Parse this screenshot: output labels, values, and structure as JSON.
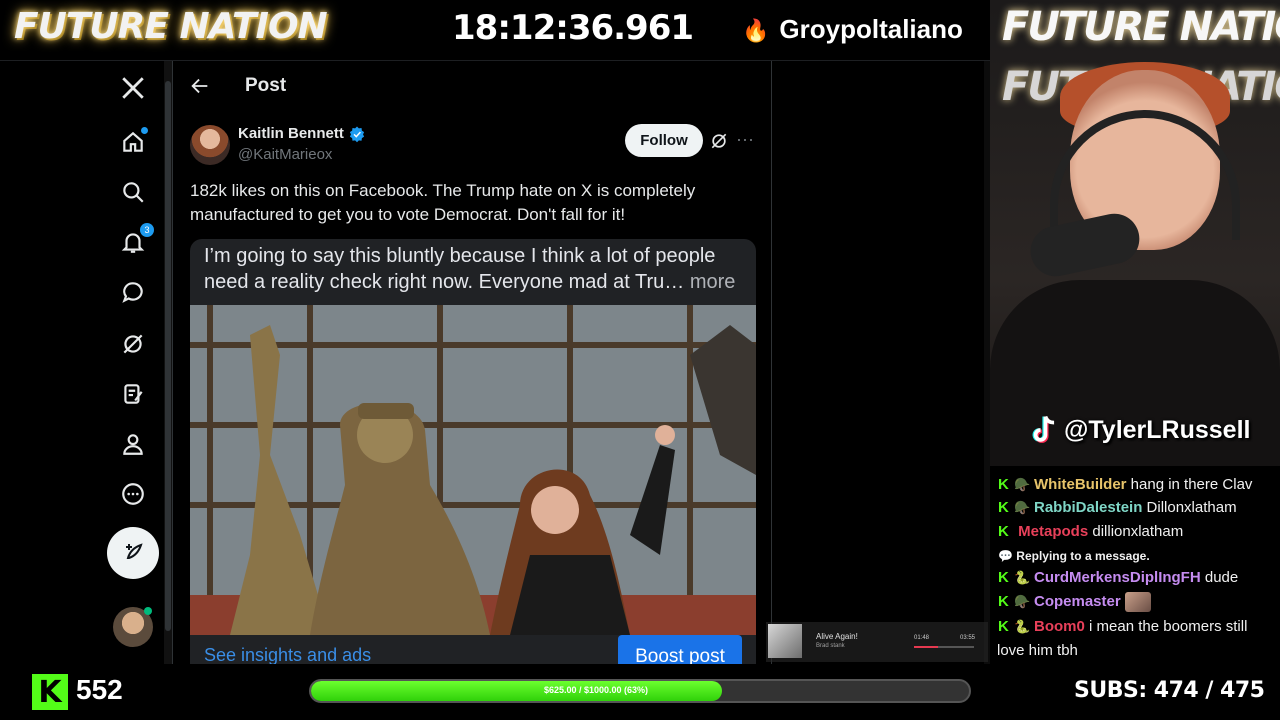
{
  "overlay": {
    "brand": "FUTURE NATION",
    "clock": "18:12:36.961",
    "donor_name": "Groypoltaliano",
    "tiktok_handle": "@TylerLRussell",
    "viewer_count": "552",
    "goal_text": "$625.00 / $1000.00 (63%)",
    "goal_progress": 0.625,
    "subs_text": "SUBS:  474 / 475"
  },
  "nav": {
    "notifications_count": "3",
    "items": [
      "x-logo",
      "home",
      "explore",
      "notifications",
      "messages",
      "grok",
      "lists",
      "profile",
      "more",
      "post"
    ]
  },
  "post_page": {
    "title": "Post",
    "author_name": "Kaitlin Bennett",
    "author_handle": "@KaitMarieox",
    "follow_label": "Follow",
    "text": "182k likes on this on Facebook. The Trump hate on X is completely manufactured to get you to vote Democrat. Don't fall for it!",
    "quote_text": "I’m going to say this bluntly because I think a lot of people need a reality check right now. Everyone mad at Tru…",
    "quote_more": "more",
    "insights_label": "See insights and ads",
    "boost_label": "Boost post"
  },
  "music": {
    "title": "Alive Again!",
    "artist": "Brad stank",
    "time_elapsed": "01:48",
    "time_total": "03:55",
    "progress": 0.4
  },
  "chat": [
    {
      "user": "WhiteBuilder",
      "color": "#e7c46a",
      "rank": "🪖",
      "message": "hang in there Clav"
    },
    {
      "user": "RabbiDalestein",
      "color": "#7fd6c6",
      "rank": "🪖",
      "message": "Dillonxlatham"
    },
    {
      "user": "Metapods",
      "color": "#e8405a",
      "rank": "",
      "message": "dillionxlatham"
    },
    {
      "reply_note": "Replying to a message."
    },
    {
      "user": "CurdMerkensDiplIngFH",
      "color": "#c58cf0",
      "rank": "🐍",
      "message": "dude"
    },
    {
      "user": "Copemaster",
      "color": "#c58cf0",
      "rank": "🪖",
      "message": ""
    },
    {
      "user": "Boom0",
      "color": "#e8405a",
      "rank": "🐍",
      "message": "i mean the boomers still",
      "continuation": "love him tbh"
    }
  ],
  "colors": {
    "kick_green": "#53fc18",
    "x_blue": "#1d9bf0",
    "boost_blue": "#1a73e8"
  }
}
